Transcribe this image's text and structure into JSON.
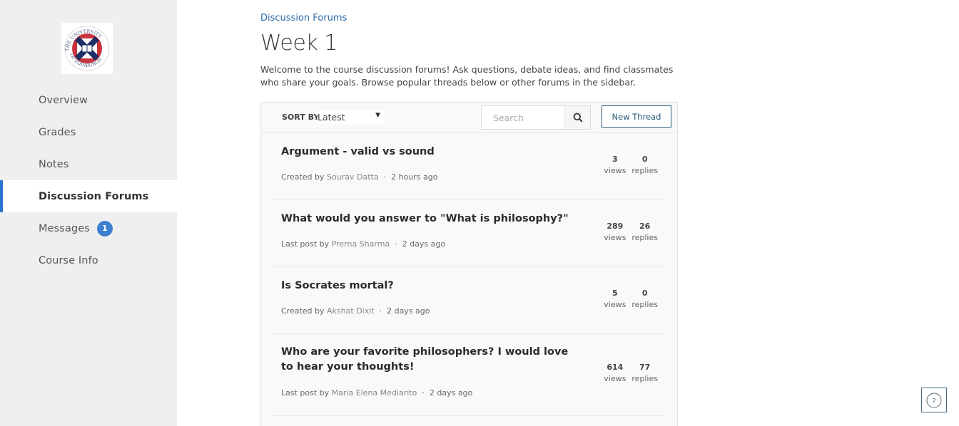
{
  "sidebar": {
    "logo_alt": "The University of Edinburgh",
    "items": [
      {
        "label": "Overview",
        "active": false
      },
      {
        "label": "Grades",
        "active": false
      },
      {
        "label": "Notes",
        "active": false
      },
      {
        "label": "Discussion Forums",
        "active": true
      },
      {
        "label": "Messages",
        "active": false,
        "badge": "1"
      },
      {
        "label": "Course Info",
        "active": false
      }
    ]
  },
  "header": {
    "breadcrumb": "Discussion Forums",
    "title": "Week 1",
    "intro": "Welcome to the course discussion forums! Ask questions, debate ideas, and find classmates who share your goals. Browse popular threads below or other forums in the sidebar."
  },
  "toolbar": {
    "sort_label": "SORT BY:",
    "sort_value": "Latest",
    "search_placeholder": "Search",
    "new_thread_label": "New Thread"
  },
  "threads": [
    {
      "title": "Argument - valid vs sound",
      "meta_prefix": "Created by",
      "author": "Sourav Datta",
      "time": "2 hours ago",
      "views": "3",
      "views_label": "views",
      "replies": "0",
      "replies_label": "replies"
    },
    {
      "title": "What would you answer to \"What is philosophy?\"",
      "meta_prefix": "Last post by",
      "author": "Prerna Sharma",
      "time": "2 days ago",
      "views": "289",
      "views_label": "views",
      "replies": "26",
      "replies_label": "replies"
    },
    {
      "title": "Is Socrates mortal?",
      "meta_prefix": "Created by",
      "author": "Akshat Dixit",
      "time": "2 days ago",
      "views": "5",
      "views_label": "views",
      "replies": "0",
      "replies_label": "replies"
    },
    {
      "title": "Who are your favorite philosophers? I would love to hear your thoughts!",
      "meta_prefix": "Last post by",
      "author": "Maria Elena Mediarito",
      "time": "2 days ago",
      "views": "614",
      "views_label": "views",
      "replies": "77",
      "replies_label": "replies"
    }
  ],
  "help": {
    "icon": "question-circle-icon"
  },
  "colors": {
    "accent": "#2a73cc",
    "badge": "#3e7fd1",
    "link": "#2a6aa8",
    "button_border": "#2a5a78"
  }
}
